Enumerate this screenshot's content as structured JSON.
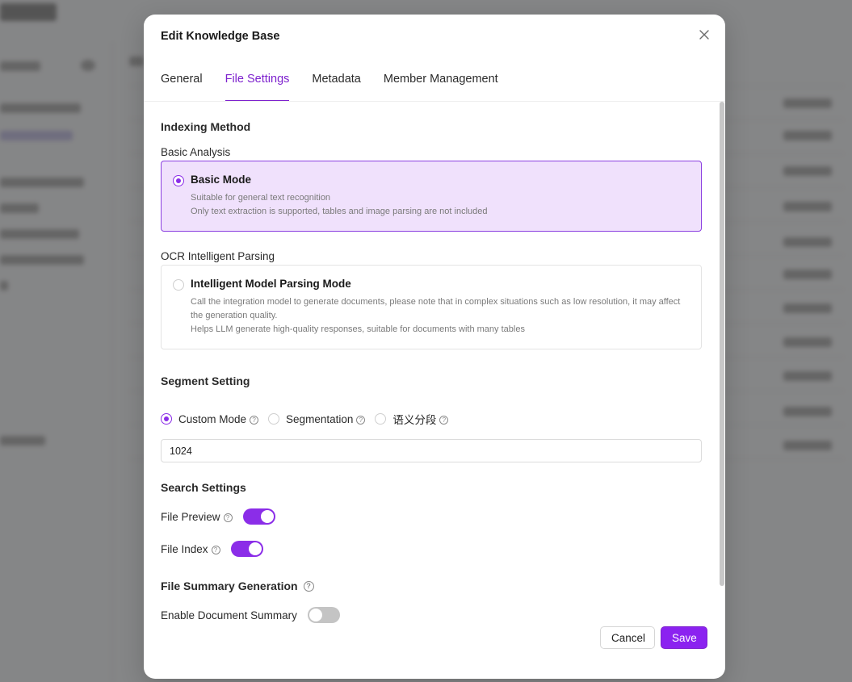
{
  "dialog": {
    "title": "Edit Knowledge Base",
    "tabs": [
      {
        "label": "General",
        "active": false
      },
      {
        "label": "File Settings",
        "active": true
      },
      {
        "label": "Metadata",
        "active": false
      },
      {
        "label": "Member Management",
        "active": false
      }
    ]
  },
  "indexing": {
    "title": "Indexing Method",
    "basic_group_label": "Basic Analysis",
    "basic_mode": {
      "title": "Basic Mode",
      "desc1": "Suitable for general text recognition",
      "desc2": "Only text extraction is supported, tables and image parsing are not included",
      "selected": true
    },
    "ocr_group_label": "OCR Intelligent Parsing",
    "model_mode": {
      "title": "Intelligent Model Parsing Mode",
      "desc1": "Call the integration model to generate documents, please note that in complex situations such as low resolution, it may affect the generation quality.",
      "desc2": "Helps LLM generate high-quality responses, suitable for documents with many tables",
      "selected": false
    }
  },
  "segment": {
    "title": "Segment Setting",
    "options": [
      {
        "label": "Custom Mode",
        "selected": true
      },
      {
        "label": "Segmentation",
        "selected": false
      },
      {
        "label": "语义分段",
        "selected": false
      }
    ],
    "value": "1024"
  },
  "search": {
    "title": "Search Settings",
    "file_preview_label": "File Preview",
    "file_preview_on": true,
    "file_index_label": "File Index",
    "file_index_on": true
  },
  "summary": {
    "title": "File Summary Generation",
    "enable_label": "Enable Document Summary",
    "enable_on": false
  },
  "footer": {
    "cancel_label": "Cancel",
    "save_label": "Save"
  },
  "icons": {
    "help": "?",
    "close": "close-icon"
  },
  "colors": {
    "accent": "#8b22f0",
    "selected_card_bg": "#f0e1fc",
    "overlay": "rgba(0,0,0,0.45)"
  }
}
